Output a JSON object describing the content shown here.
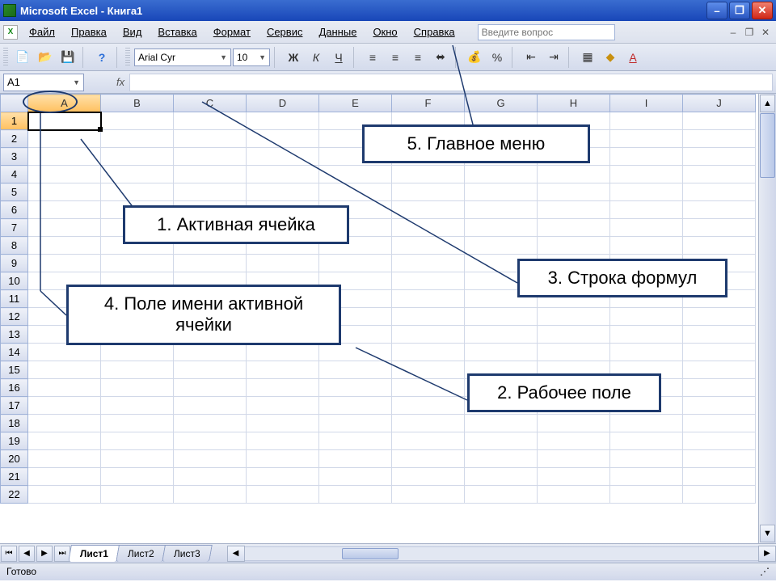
{
  "titlebar": {
    "text": "Microsoft Excel - Книга1"
  },
  "menu": {
    "items": [
      "Файл",
      "Правка",
      "Вид",
      "Вставка",
      "Формат",
      "Сервис",
      "Данные",
      "Окно",
      "Справка"
    ],
    "help_placeholder": "Введите вопрос"
  },
  "toolbar": {
    "font_name": "Arial Cyr",
    "font_size": "10",
    "bold": "Ж",
    "italic": "К",
    "underline": "Ч"
  },
  "fxrow": {
    "namebox": "A1",
    "fx_label": "fx"
  },
  "columns": [
    "A",
    "B",
    "C",
    "D",
    "E",
    "F",
    "G",
    "H",
    "I",
    "J"
  ],
  "rows_visible": 22,
  "tabs": [
    "Лист1",
    "Лист2",
    "Лист3"
  ],
  "status": {
    "ready": "Готово"
  },
  "callouts": {
    "c1": "1.  Активная ячейка",
    "c2": "2. Рабочее поле",
    "c3": "3. Строка формул",
    "c4": "4. Поле имени активной ячейки",
    "c5": "5. Главное меню"
  }
}
